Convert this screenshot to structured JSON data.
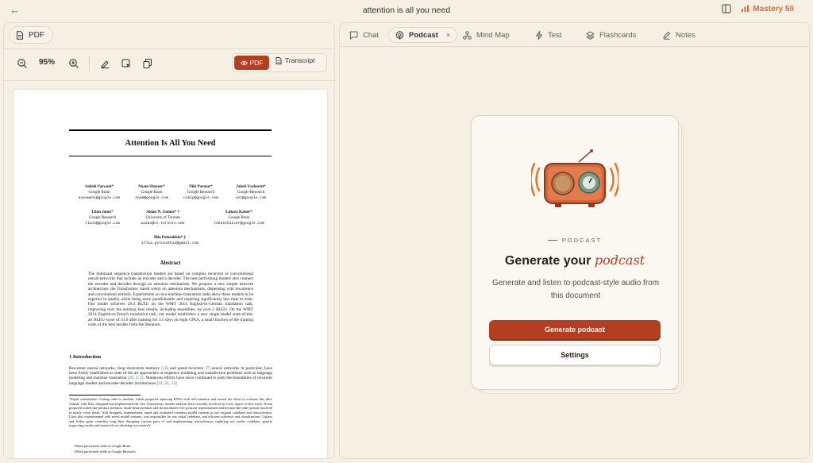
{
  "app": {
    "document_title": "attention is all you need",
    "mastery_label": "Mastery 50"
  },
  "colors": {
    "accent": "#b33e22",
    "mastery": "#e06b2b",
    "background": "#f5efe4"
  },
  "left_panel": {
    "tab_label": "PDF",
    "zoom": "95%",
    "view_toggle": {
      "pdf": "PDF",
      "transcript": "Transcript"
    }
  },
  "paper": {
    "title": "Attention Is All You Need",
    "authors": [
      {
        "name": "Ashish Vaswani*",
        "affil": "Google Brain",
        "email": "avaswani@google.com"
      },
      {
        "name": "Noam Shazeer*",
        "affil": "Google Brain",
        "email": "noam@google.com"
      },
      {
        "name": "Niki Parmar*",
        "affil": "Google Research",
        "email": "nikip@google.com"
      },
      {
        "name": "Jakob Uszkoreit*",
        "affil": "Google Research",
        "email": "usz@google.com"
      },
      {
        "name": "Llion Jones*",
        "affil": "Google Research",
        "email": "llion@google.com"
      },
      {
        "name": "Aidan N. Gomez* †",
        "affil": "University of Toronto",
        "email": "aidan@cs.toronto.edu"
      },
      {
        "name": "Łukasz Kaiser*",
        "affil": "Google Brain",
        "email": "lukaszkaiser@google.com"
      },
      {
        "name": "Illia Polosukhin* ‡",
        "affil": "",
        "email": "illia.polosukhin@gmail.com"
      }
    ],
    "abstract_title": "Abstract",
    "abstract": "The dominant sequence transduction models are based on complex recurrent or convolutional neural networks that include an encoder and a decoder. The best performing models also connect the encoder and decoder through an attention mechanism. We propose a new simple network architecture, the Transformer, based solely on attention mechanisms, dispensing with recurrence and convolutions entirely. Experiments on two machine translation tasks show these models to be superior in quality while being more parallelizable and requiring significantly less time to train. Our model achieves 28.4 BLEU on the WMT 2014 English-to-German translation task, improving over the existing best results, including ensembles, by over 2 BLEU. On the WMT 2014 English-to-French translation task, our model establishes a new single-model state-of-the-art BLEU score of 41.0 after training for 3.5 days on eight GPUs, a small fraction of the training costs of the best models from the literature.",
    "section_title": "1   Introduction",
    "intro_a": "Recurrent neural networks, long short-term memory ",
    "cite1": "[12]",
    "intro_b": " and gated recurrent ",
    "cite2": "[7]",
    "intro_c": " neural networks in particular, have been firmly established as state of the art approaches in sequence modeling and transduction problems such as language modeling and machine translation ",
    "cite3": "[29, 2, 5]",
    "intro_d": ". Numerous efforts have since continued to push the boundaries of recurrent language models and encoder-decoder architectures ",
    "cite4": "[31, 21, 13]",
    "intro_e": ".",
    "footnote_main": "*Equal contribution. Listing order is random. Jakob proposed replacing RNNs with self-attention and started the effort to evaluate this idea. Ashish, with Illia, designed and implemented the first Transformer models and has been crucially involved in every aspect of this work. Noam proposed scaled dot-product attention, multi-head attention and the parameter-free position representation and became the other person involved in nearly every detail. Niki designed, implemented, tuned and evaluated countless model variants in our original codebase and tensor2tensor. Llion also experimented with novel model variants, was responsible for our initial codebase, and efficient inference and visualizations. Lukasz and Aidan spent countless long days designing various parts of and implementing tensor2tensor, replacing our earlier codebase, greatly improving results and massively accelerating our research.",
    "footnote_brain": "†Work performed while at Google Brain.",
    "footnote_research": "‡Work performed while at Google Research."
  },
  "right_panel": {
    "tabs": [
      {
        "label": "Chat",
        "icon": "chat-icon"
      },
      {
        "label": "Podcast",
        "icon": "podcast-icon",
        "active": true
      },
      {
        "label": "Mind Map",
        "icon": "mind-map-icon"
      },
      {
        "label": "Test",
        "icon": "lightning-icon"
      },
      {
        "label": "Flashcards",
        "icon": "layers-icon"
      },
      {
        "label": "Notes",
        "icon": "pencil-icon"
      }
    ],
    "card": {
      "eyebrow": "PODCAST",
      "title_plain": "Generate your ",
      "title_em": "podcast",
      "subtitle": "Generate and listen to podcast-style audio from this document",
      "primary_button": "Generate podcast",
      "secondary_button": "Settings"
    }
  }
}
